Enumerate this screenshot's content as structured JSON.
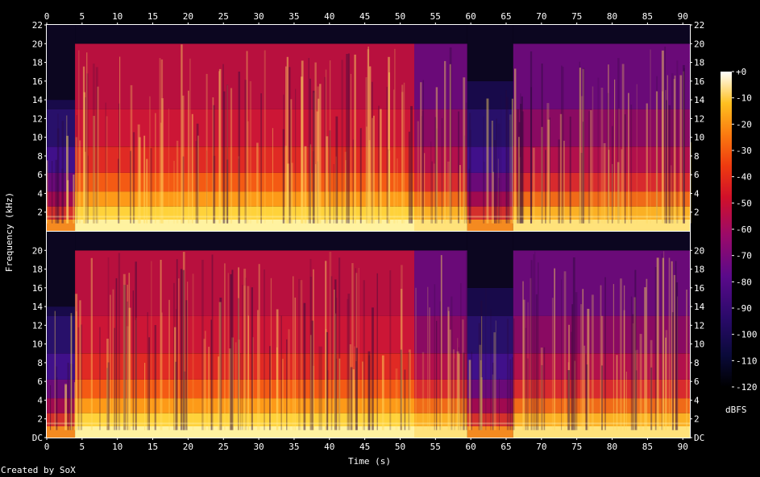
{
  "chart_data": {
    "type": "heatmap",
    "title": "",
    "channels": 2,
    "xlabel": "Time (s)",
    "ylabel": "Frequency (kHz)",
    "xlim": [
      0,
      91
    ],
    "ylim_khz": [
      0,
      22
    ],
    "x_ticks": [
      "0",
      "5",
      "10",
      "15",
      "20",
      "25",
      "30",
      "35",
      "40",
      "45",
      "50",
      "55",
      "60",
      "65",
      "70",
      "75",
      "80",
      "85",
      "90"
    ],
    "y_ticks_top": [
      "2",
      "4",
      "6",
      "8",
      "10",
      "12",
      "14",
      "16",
      "18",
      "20",
      "22"
    ],
    "y_ticks_bottom": [
      "DC",
      "2",
      "4",
      "6",
      "8",
      "10",
      "12",
      "14",
      "16",
      "18",
      "20"
    ],
    "y_ticks_right_top": [
      "2",
      "4",
      "6",
      "8",
      "10",
      "12",
      "14",
      "16",
      "18",
      "20",
      "22"
    ],
    "y_ticks_right_bottom": [
      "DC",
      "2",
      "4",
      "6",
      "8",
      "10",
      "12",
      "14",
      "16",
      "18",
      "20"
    ],
    "colorbar": {
      "label": "dBFS",
      "ticks": [
        "+0",
        "-10",
        "-20",
        "-30",
        "-40",
        "-50",
        "-60",
        "-70",
        "-80",
        "-90",
        "-100",
        "-110",
        "-120"
      ],
      "range_db": [
        -120,
        0
      ]
    },
    "segments": [
      {
        "start_s": 0,
        "end_s": 4,
        "cutoff_khz": 14,
        "level": "low"
      },
      {
        "start_s": 4,
        "end_s": 52,
        "cutoff_khz": 20,
        "level": "high"
      },
      {
        "start_s": 52,
        "end_s": 59.5,
        "cutoff_khz": 20,
        "level": "medium"
      },
      {
        "start_s": 59.5,
        "end_s": 66,
        "cutoff_khz": 16,
        "level": "low"
      },
      {
        "start_s": 66,
        "end_s": 91,
        "cutoff_khz": 20,
        "level": "medium"
      }
    ]
  },
  "footer": {
    "credit": "Created by SoX"
  },
  "colors": {
    "background": "#000000",
    "axis": "#ffffff"
  }
}
